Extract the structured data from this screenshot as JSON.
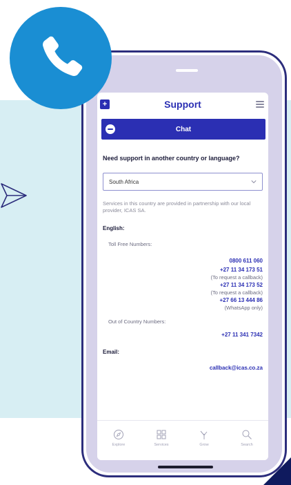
{
  "app": {
    "title": "Support",
    "chat_label": "Chat"
  },
  "support": {
    "question": "Need support in another country or language?",
    "country_selected": "South Africa",
    "partner_note": "Services in this country are provided in partnership with our local provider, ICAS SA.",
    "english_label": "English:",
    "toll_free_label": "Toll Free Numbers:",
    "toll_free": [
      {
        "number": "0800 611 060",
        "note": ""
      },
      {
        "number": "+27 11 34 173 51",
        "note": "(To request a callback)"
      },
      {
        "number": "+27 11 34 173 52",
        "note": "(To request a callback)"
      },
      {
        "number": "+27 66 13 444 86",
        "note": "(WhatsApp only)"
      }
    ],
    "out_of_country_label": "Out of Country Numbers:",
    "out_of_country_number": "+27 11 341 7342",
    "email_label": "Email:",
    "email": "callback@icas.co.za"
  },
  "nav": [
    {
      "label": "Explore",
      "icon": "compass-icon"
    },
    {
      "label": "Services",
      "icon": "grid-icon"
    },
    {
      "label": "Grow",
      "icon": "sprout-icon"
    },
    {
      "label": "Search",
      "icon": "search-icon"
    }
  ],
  "colors": {
    "brand": "#2b2fb3",
    "badge": "#1a8ed3",
    "panel": "#d7eef3",
    "frame": "#2c2d7c"
  }
}
